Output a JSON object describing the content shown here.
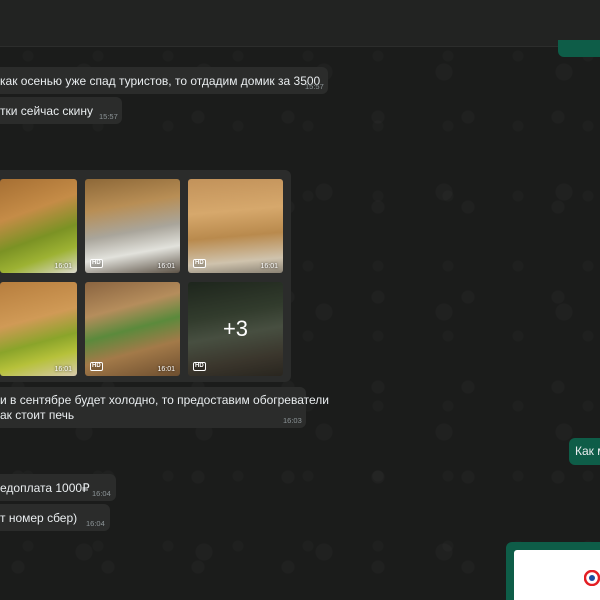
{
  "messages": [
    {
      "text": "как осенью уже спад туристов, то отдадим домик за 3500",
      "time": "15:57"
    },
    {
      "text": "тки сейчас скину",
      "time": "15:57"
    },
    {
      "text_line1": "и в сентябре будет холодно, то предоставим обогреватели",
      "text_line2": "ак стоит печь",
      "time": "16:03"
    },
    {
      "text": "едоплата 1000₽",
      "time": "16:04"
    },
    {
      "text": "т номер сбер)",
      "time": "16:04"
    }
  ],
  "media": {
    "items": [
      {
        "time": "16:01",
        "hd": "",
        "scene": "bedroom-green"
      },
      {
        "time": "16:01",
        "hd": "HD",
        "scene": "bathroom"
      },
      {
        "time": "16:01",
        "hd": "HD",
        "scene": "wood-room"
      },
      {
        "time": "16:01",
        "hd": "",
        "scene": "bedroom-twin"
      },
      {
        "time": "16:01",
        "hd": "HD",
        "scene": "veranda"
      },
      {
        "time": "",
        "hd": "HD",
        "scene": "forest",
        "more": "+3"
      }
    ]
  },
  "sent": {
    "text": "Как м"
  },
  "card": {
    "logo_text": "С",
    "accent": "#e31e24"
  },
  "colors": {
    "bubble_in": "#2b2c2b",
    "bubble_out": "#0e5d48",
    "text": "#e9edef",
    "meta": "#8d9598"
  }
}
